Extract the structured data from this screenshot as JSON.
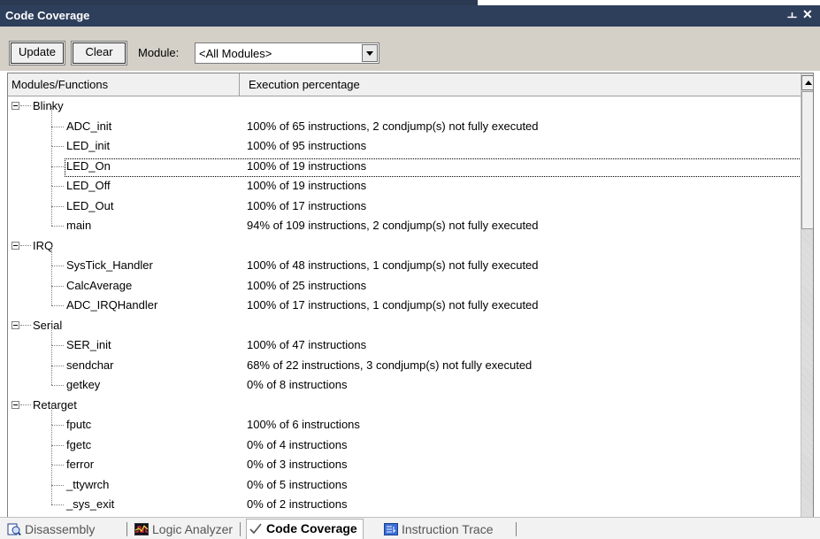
{
  "window": {
    "title": "Code Coverage",
    "pin_glyph": "ㅗ",
    "close_glyph": "✕"
  },
  "toolbar": {
    "update_label": "Update",
    "clear_label": "Clear",
    "module_label": "Module:",
    "module_value": "<All Modules>"
  },
  "columns": {
    "col1": "Modules/Functions",
    "col2": "Execution percentage"
  },
  "groups": [
    {
      "name": "Blinky",
      "functions": [
        {
          "name": "ADC_init",
          "exec": "100% of 65 instructions, 2 condjump(s) not fully executed"
        },
        {
          "name": "LED_init",
          "exec": "100% of 95 instructions"
        },
        {
          "name": "LED_On",
          "exec": "100% of 19 instructions",
          "selected": true
        },
        {
          "name": "LED_Off",
          "exec": "100% of 19 instructions"
        },
        {
          "name": "LED_Out",
          "exec": "100% of 17 instructions"
        },
        {
          "name": "main",
          "exec": "94% of 109 instructions, 2 condjump(s) not fully executed"
        }
      ]
    },
    {
      "name": "IRQ",
      "functions": [
        {
          "name": "SysTick_Handler",
          "exec": "100% of 48 instructions, 1 condjump(s) not fully executed"
        },
        {
          "name": "CalcAverage",
          "exec": "100% of 25 instructions"
        },
        {
          "name": "ADC_IRQHandler",
          "exec": "100% of 17 instructions, 1 condjump(s) not fully executed"
        }
      ]
    },
    {
      "name": "Serial",
      "functions": [
        {
          "name": "SER_init",
          "exec": "100% of 47 instructions"
        },
        {
          "name": "sendchar",
          "exec": "68% of 22 instructions, 3 condjump(s) not fully executed"
        },
        {
          "name": "getkey",
          "exec": "0% of 8 instructions"
        }
      ]
    },
    {
      "name": "Retarget",
      "functions": [
        {
          "name": "fputc",
          "exec": "100% of 6 instructions"
        },
        {
          "name": "fgetc",
          "exec": "0% of 4 instructions"
        },
        {
          "name": "ferror",
          "exec": "0% of 3 instructions"
        },
        {
          "name": "_ttywrch",
          "exec": "0% of 5 instructions"
        },
        {
          "name": "_sys_exit",
          "exec": "0% of 2 instructions"
        }
      ]
    }
  ],
  "tabs": [
    {
      "label": "Disassembly",
      "icon": "disassembly-icon",
      "active": false
    },
    {
      "label": "Logic Analyzer",
      "icon": "logic-analyzer-icon",
      "active": false
    },
    {
      "label": "Code Coverage",
      "icon": "code-coverage-icon",
      "active": true
    },
    {
      "label": "Instruction Trace",
      "icon": "instruction-trace-icon",
      "active": false
    }
  ],
  "colors": {
    "titlebar": "#2e3f5c",
    "toolbar": "#d4d0c8"
  }
}
